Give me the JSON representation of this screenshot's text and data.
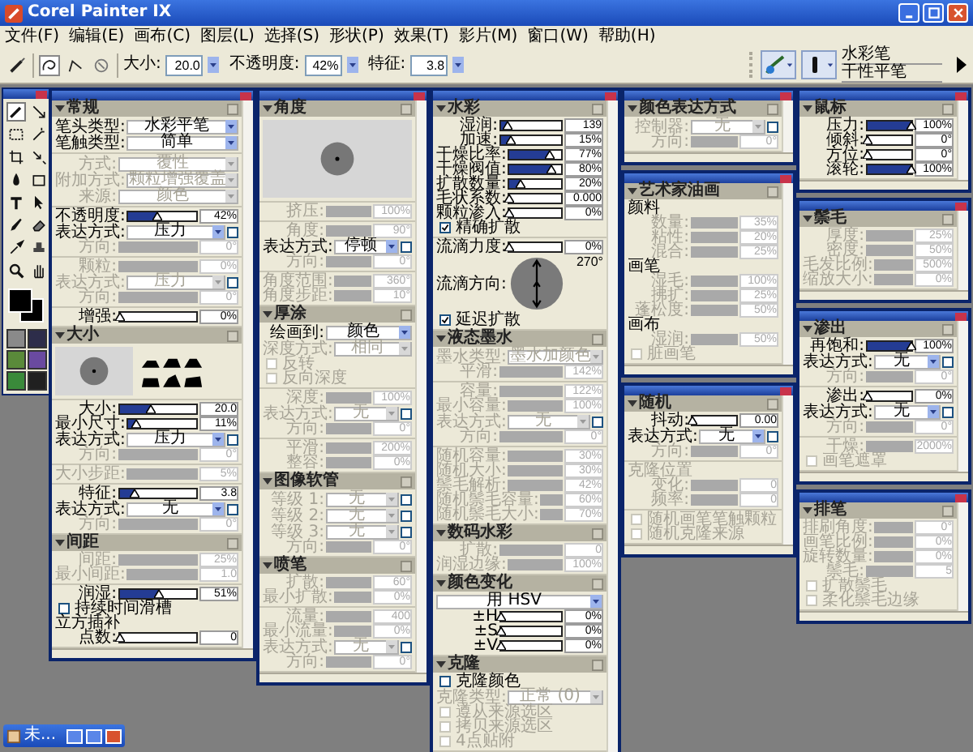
{
  "window": {
    "title": "Corel Painter IX"
  },
  "menu": [
    "文件(F)",
    "编辑(E)",
    "画布(C)",
    "图层(L)",
    "选择(S)",
    "形状(P)",
    "效果(T)",
    "影片(M)",
    "窗口(W)",
    "帮助(H)"
  ],
  "toolbar": {
    "fields": [
      {
        "label": "大小:",
        "value": "20.0"
      },
      {
        "label": "不透明度:",
        "value": "42%"
      },
      {
        "label": "特征:",
        "value": "3.8"
      }
    ],
    "brush": {
      "category": "水彩笔",
      "variant": "干性平笔"
    }
  },
  "toolbox": {
    "tools": [
      {
        "selected": true
      },
      {
        "selected": false
      },
      {
        "selected": false
      },
      {
        "selected": false
      },
      {
        "selected": false
      },
      {
        "selected": false
      },
      {
        "selected": false
      },
      {
        "selected": false
      },
      {
        "selected": false
      },
      {
        "selected": false
      },
      {
        "selected": false
      },
      {
        "selected": false
      },
      {
        "selected": false
      },
      {
        "selected": false
      },
      {
        "selected": false
      },
      {
        "selected": false
      }
    ]
  },
  "palette_columns": [
    {
      "panels": [
        {
          "sections": [
            {
              "title": "常规",
              "groups": [
                {
                  "rows": [
                    {
                      "kind": "select",
                      "label": "笔头类型:",
                      "value": "水彩平笔",
                      "disabled": false
                    },
                    {
                      "kind": "select",
                      "label": "笔触类型:",
                      "value": "简单",
                      "disabled": false
                    }
                  ]
                },
                {
                  "rows": [
                    {
                      "kind": "select",
                      "label": "方式:",
                      "value": "覆性",
                      "disabled": true
                    },
                    {
                      "kind": "select",
                      "label": "附加方式:",
                      "value": "颗粒增强覆盖",
                      "disabled": true
                    },
                    {
                      "kind": "select",
                      "label": "来源:",
                      "value": "颜色",
                      "disabled": true
                    }
                  ]
                },
                {
                  "rows": [
                    {
                      "kind": "slider",
                      "label": "不透明度:",
                      "value": "42%",
                      "level": 0.42,
                      "disabled": false
                    },
                    {
                      "kind": "select",
                      "label": "表达方式:",
                      "value": "压力",
                      "disabled": false,
                      "toggle": {
                        "checked": false
                      }
                    },
                    {
                      "kind": "slider",
                      "label": "方向:",
                      "value": "0°",
                      "disabled": true
                    }
                  ]
                },
                {
                  "rows": [
                    {
                      "kind": "slider",
                      "label": "颗粒:",
                      "value": "0%",
                      "disabled": true
                    },
                    {
                      "kind": "select",
                      "label": "表达方式:",
                      "value": "压力",
                      "disabled": true,
                      "toggle": {
                        "checked": false
                      }
                    },
                    {
                      "kind": "slider",
                      "label": "方向:",
                      "value": "0°",
                      "disabled": true
                    }
                  ]
                },
                {
                  "rows": [
                    {
                      "kind": "slider",
                      "label": "增强:",
                      "value": "0%",
                      "level": 0,
                      "disabled": false
                    }
                  ]
                }
              ]
            },
            {
              "title": "大小",
              "groups": [
                {
                  "rows": [
                    {
                      "kind": "size_preview"
                    }
                  ]
                },
                {
                  "rows": [
                    {
                      "kind": "slider",
                      "label": "大小:",
                      "value": "20.0",
                      "level": 0.4,
                      "disabled": false
                    },
                    {
                      "kind": "slider",
                      "label": "最小尺寸:",
                      "value": "11%",
                      "level": 0.11,
                      "disabled": false
                    },
                    {
                      "kind": "select",
                      "label": "表达方式:",
                      "value": "压力",
                      "disabled": false,
                      "toggle": {
                        "checked": false
                      }
                    },
                    {
                      "kind": "slider",
                      "label": "方向:",
                      "value": "0°",
                      "disabled": true
                    }
                  ]
                },
                {
                  "rows": [
                    {
                      "kind": "slider",
                      "label": "大小步距:",
                      "value": "5%",
                      "disabled": true
                    }
                  ]
                },
                {
                  "rows": [
                    {
                      "kind": "slider",
                      "label": "特征:",
                      "value": "3.8",
                      "level": 0.2,
                      "disabled": false
                    },
                    {
                      "kind": "select",
                      "label": "表达方式:",
                      "value": "无",
                      "disabled": false,
                      "toggle": {
                        "checked": false
                      }
                    },
                    {
                      "kind": "slider",
                      "label": "方向:",
                      "value": "0°",
                      "disabled": true
                    }
                  ]
                }
              ]
            },
            {
              "title": "间距",
              "groups": [
                {
                  "rows": [
                    {
                      "kind": "slider",
                      "label": "间距:",
                      "value": "25%",
                      "disabled": true
                    },
                    {
                      "kind": "slider",
                      "label": "最小间距:",
                      "value": "1.0",
                      "disabled": true
                    }
                  ]
                },
                {
                  "rows": [
                    {
                      "kind": "slider",
                      "label": "润湿:",
                      "value": "51%",
                      "level": 0.51,
                      "disabled": false
                    },
                    {
                      "kind": "check",
                      "label": "持续时间滑槽",
                      "checked": false,
                      "disabled": false
                    },
                    {
                      "kind": "note",
                      "text": "立方插补",
                      "disabled": false
                    },
                    {
                      "kind": "slider",
                      "label": "点数:",
                      "value": "0",
                      "level": 0,
                      "disabled": false
                    }
                  ]
                }
              ]
            }
          ]
        }
      ]
    },
    {
      "panels": [
        {
          "sections": [
            {
              "title": "角度",
              "groups": [
                {
                  "rows": [
                    {
                      "kind": "dab"
                    }
                  ]
                },
                {
                  "rows": [
                    {
                      "kind": "slider",
                      "label": "挤压:",
                      "value": "100%",
                      "disabled": true
                    }
                  ]
                },
                {
                  "rows": [
                    {
                      "kind": "slider",
                      "label": "角度:",
                      "value": "90°",
                      "disabled": true
                    },
                    {
                      "kind": "select",
                      "label": "表达方式:",
                      "value": "停顿",
                      "disabled": false,
                      "toggle": {
                        "checked": false
                      }
                    },
                    {
                      "kind": "slider",
                      "label": "方向:",
                      "value": "0°",
                      "disabled": true
                    }
                  ]
                },
                {
                  "rows": [
                    {
                      "kind": "slider",
                      "label": "角度范围:",
                      "value": "360°",
                      "disabled": true
                    },
                    {
                      "kind": "slider",
                      "label": "角度步距:",
                      "value": "10°",
                      "disabled": true
                    }
                  ]
                }
              ]
            },
            {
              "title": "厚涂",
              "groups": [
                {
                  "rows": [
                    {
                      "kind": "select",
                      "label": "绘画到:",
                      "value": "颜色",
                      "disabled": false
                    },
                    {
                      "kind": "select",
                      "label": "深度方式:",
                      "value": "相同",
                      "disabled": true
                    },
                    {
                      "kind": "check",
                      "label": "反转",
                      "checked": false,
                      "disabled": true
                    },
                    {
                      "kind": "check",
                      "label": "反向深度",
                      "checked": false,
                      "disabled": true
                    }
                  ]
                },
                {
                  "rows": [
                    {
                      "kind": "slider",
                      "label": "深度:",
                      "value": "100%",
                      "disabled": true
                    },
                    {
                      "kind": "select",
                      "label": "表达方式:",
                      "value": "无",
                      "disabled": true,
                      "toggle": {
                        "checked": false
                      }
                    },
                    {
                      "kind": "slider",
                      "label": "方向:",
                      "value": "0°",
                      "disabled": true
                    }
                  ]
                },
                {
                  "rows": [
                    {
                      "kind": "slider",
                      "label": "平滑:",
                      "value": "200%",
                      "disabled": true
                    },
                    {
                      "kind": "slider",
                      "label": "整容:",
                      "value": "0%",
                      "disabled": true
                    }
                  ]
                }
              ]
            },
            {
              "title": "图像软管",
              "groups": [
                {
                  "rows": [
                    {
                      "kind": "select",
                      "label": "等级 1:",
                      "value": "无",
                      "disabled": true,
                      "toggle": {
                        "checked": false
                      }
                    },
                    {
                      "kind": "select",
                      "label": "等级 2:",
                      "value": "无",
                      "disabled": true,
                      "toggle": {
                        "checked": false
                      }
                    },
                    {
                      "kind": "select",
                      "label": "等级 3:",
                      "value": "无",
                      "disabled": true,
                      "toggle": {
                        "checked": false
                      }
                    },
                    {
                      "kind": "slider",
                      "label": "方向:",
                      "value": "0°",
                      "disabled": true
                    }
                  ]
                }
              ]
            },
            {
              "title": "喷笔",
              "groups": [
                {
                  "rows": [
                    {
                      "kind": "slider",
                      "label": "扩散:",
                      "value": "60°",
                      "disabled": true
                    },
                    {
                      "kind": "slider",
                      "label": "最小扩散:",
                      "value": "0%",
                      "disabled": true
                    }
                  ]
                },
                {
                  "rows": [
                    {
                      "kind": "slider",
                      "label": "流量:",
                      "value": "400",
                      "disabled": true
                    },
                    {
                      "kind": "slider",
                      "label": "最小流量:",
                      "value": "0%",
                      "disabled": true
                    },
                    {
                      "kind": "select",
                      "label": "表达方式:",
                      "value": "无",
                      "disabled": true,
                      "toggle": {
                        "checked": false
                      }
                    },
                    {
                      "kind": "slider",
                      "label": "方向:",
                      "value": "0°",
                      "disabled": true
                    }
                  ]
                }
              ]
            }
          ]
        }
      ]
    },
    {
      "panels": [
        {
          "sections": [
            {
              "title": "水彩",
              "groups": [
                {
                  "rows": [
                    {
                      "kind": "slider",
                      "label": "湿润:",
                      "value": "139",
                      "level": 0.12,
                      "disabled": false
                    },
                    {
                      "kind": "slider",
                      "label": "加速:",
                      "value": "15%",
                      "level": 0.15,
                      "disabled": false
                    },
                    {
                      "kind": "slider",
                      "label": "干燥比率:",
                      "value": "77%",
                      "level": 0.77,
                      "disabled": false
                    },
                    {
                      "kind": "slider",
                      "label": "干燥阀值:",
                      "value": "80%",
                      "level": 0.8,
                      "disabled": false
                    },
                    {
                      "kind": "slider",
                      "label": "扩散数量:",
                      "value": "20%",
                      "level": 0.2,
                      "disabled": false
                    },
                    {
                      "kind": "slider",
                      "label": "毛状系数:",
                      "value": "0.000",
                      "level": 0,
                      "disabled": false
                    },
                    {
                      "kind": "slider",
                      "label": "颗粒渗入:",
                      "value": "0%",
                      "level": 0,
                      "disabled": false
                    },
                    {
                      "kind": "check",
                      "label": "精确扩散",
                      "checked": true,
                      "disabled": false
                    }
                  ]
                },
                {
                  "rows": [
                    {
                      "kind": "slider",
                      "label": "流滴力度:",
                      "value": "0%",
                      "level": 0,
                      "disabled": false
                    },
                    {
                      "kind": "dial",
                      "label": "流滴方向:",
                      "value": "270°"
                    },
                    {
                      "kind": "check",
                      "label": "延迟扩散",
                      "checked": true,
                      "disabled": false
                    }
                  ]
                }
              ]
            },
            {
              "title": "液态墨水",
              "groups": [
                {
                  "rows": [
                    {
                      "kind": "select",
                      "label": "墨水类型:",
                      "value": "墨水加颜色",
                      "disabled": true
                    },
                    {
                      "kind": "slider",
                      "label": "平滑:",
                      "value": "142%",
                      "disabled": true
                    }
                  ]
                },
                {
                  "rows": [
                    {
                      "kind": "slider",
                      "label": "容量:",
                      "value": "122%",
                      "disabled": true
                    },
                    {
                      "kind": "slider",
                      "label": "最小容量:",
                      "value": "100%",
                      "disabled": true
                    },
                    {
                      "kind": "select",
                      "label": "表达方式:",
                      "value": "无",
                      "disabled": true,
                      "toggle": {
                        "checked": false
                      }
                    },
                    {
                      "kind": "slider",
                      "label": "方向:",
                      "value": "0°",
                      "disabled": true
                    }
                  ]
                },
                {
                  "rows": [
                    {
                      "kind": "slider",
                      "label": "随机容量:",
                      "value": "30%",
                      "disabled": true
                    },
                    {
                      "kind": "slider",
                      "label": "随机大小:",
                      "value": "30%",
                      "disabled": true
                    },
                    {
                      "kind": "slider",
                      "label": "鬃毛解析:",
                      "value": "42%",
                      "disabled": true
                    },
                    {
                      "kind": "slider",
                      "label": "随机鬃毛容量:",
                      "value": "60%",
                      "disabled": true
                    },
                    {
                      "kind": "slider",
                      "label": "随机鬃毛大小:",
                      "value": "70%",
                      "disabled": true
                    }
                  ]
                }
              ]
            },
            {
              "title": "数码水彩",
              "groups": [
                {
                  "rows": [
                    {
                      "kind": "slider",
                      "label": "扩散:",
                      "value": "0",
                      "disabled": true
                    },
                    {
                      "kind": "slider",
                      "label": "润湿边缘:",
                      "value": "100%",
                      "disabled": true
                    }
                  ]
                }
              ]
            },
            {
              "title": "颜色变化",
              "groups": [
                {
                  "rows": [
                    {
                      "kind": "select",
                      "value": "用 HSV",
                      "disabled": false
                    },
                    {
                      "kind": "slider",
                      "label": "±H",
                      "value": "0%",
                      "level": 0,
                      "disabled": false
                    },
                    {
                      "kind": "slider",
                      "label": "±S",
                      "value": "0%",
                      "level": 0,
                      "disabled": false
                    },
                    {
                      "kind": "slider",
                      "label": "±V",
                      "value": "0%",
                      "level": 0,
                      "disabled": false
                    }
                  ]
                }
              ]
            },
            {
              "title": "克隆",
              "groups": [
                {
                  "rows": [
                    {
                      "kind": "check",
                      "label": "克隆颜色",
                      "checked": false,
                      "disabled": false
                    },
                    {
                      "kind": "select",
                      "label": "克隆类型:",
                      "value": "正常 (0)",
                      "disabled": true
                    },
                    {
                      "kind": "check",
                      "label": "遵从来源选区",
                      "checked": false,
                      "disabled": true
                    },
                    {
                      "kind": "check",
                      "label": "拷贝来源选区",
                      "checked": false,
                      "disabled": true
                    },
                    {
                      "kind": "check",
                      "label": "4点贴附",
                      "checked": false,
                      "disabled": true
                    }
                  ]
                }
              ]
            }
          ]
        }
      ]
    },
    {
      "panels": [
        {
          "sections": [
            {
              "title": "颜色表达方式",
              "groups": [
                {
                  "rows": [
                    {
                      "kind": "select",
                      "label": "控制器:",
                      "value": "无",
                      "disabled": true,
                      "toggle": {
                        "checked": false
                      }
                    },
                    {
                      "kind": "slider",
                      "label": "方向:",
                      "value": "0°",
                      "disabled": true
                    }
                  ]
                }
              ]
            }
          ]
        },
        {
          "sections": [
            {
              "title": "艺术家油画",
              "groups": [
                {
                  "rows": [
                    {
                      "kind": "note",
                      "text": "颜料",
                      "disabled": false
                    },
                    {
                      "kind": "slider",
                      "label": "数量:",
                      "value": "35%",
                      "disabled": true
                    },
                    {
                      "kind": "slider",
                      "label": "粘性:",
                      "value": "20%",
                      "disabled": true
                    },
                    {
                      "kind": "slider",
                      "label": "混合:",
                      "value": "25%",
                      "disabled": true
                    },
                    {
                      "kind": "note",
                      "text": "画笔",
                      "disabled": false
                    },
                    {
                      "kind": "slider",
                      "label": "湿毛:",
                      "value": "100%",
                      "disabled": true
                    },
                    {
                      "kind": "slider",
                      "label": "拂扩:",
                      "value": "25%",
                      "disabled": true
                    },
                    {
                      "kind": "slider",
                      "label": "蓬松度:",
                      "value": "50%",
                      "disabled": true
                    },
                    {
                      "kind": "note",
                      "text": "画布",
                      "disabled": false
                    },
                    {
                      "kind": "slider",
                      "label": "湿润:",
                      "value": "50%",
                      "disabled": true
                    },
                    {
                      "kind": "check",
                      "label": "脏画笔",
                      "checked": false,
                      "disabled": true
                    }
                  ]
                }
              ]
            }
          ]
        },
        {
          "sections": [
            {
              "title": "随机",
              "groups": [
                {
                  "rows": [
                    {
                      "kind": "slider",
                      "label": "抖动:",
                      "value": "0.00",
                      "level": 0,
                      "disabled": false
                    },
                    {
                      "kind": "select",
                      "label": "表达方式:",
                      "value": "无",
                      "disabled": false,
                      "toggle": {
                        "checked": false
                      }
                    },
                    {
                      "kind": "slider",
                      "label": "方向:",
                      "value": "0°",
                      "disabled": true
                    }
                  ]
                },
                {
                  "rows": [
                    {
                      "kind": "note",
                      "text": "克隆位置",
                      "disabled": true
                    },
                    {
                      "kind": "slider",
                      "label": "变化:",
                      "value": "0",
                      "disabled": true
                    },
                    {
                      "kind": "slider",
                      "label": "频率:",
                      "value": "0",
                      "disabled": true
                    }
                  ]
                },
                {
                  "rows": [
                    {
                      "kind": "check",
                      "label": "随机画笔笔触颗粒",
                      "checked": false,
                      "disabled": true
                    },
                    {
                      "kind": "check",
                      "label": "随机克隆来源",
                      "checked": false,
                      "disabled": true
                    }
                  ]
                }
              ]
            }
          ]
        }
      ]
    },
    {
      "panels": [
        {
          "sections": [
            {
              "title": "鼠标",
              "groups": [
                {
                  "rows": [
                    {
                      "kind": "slider",
                      "label": "压力:",
                      "value": "100%",
                      "level": 1,
                      "disabled": false
                    },
                    {
                      "kind": "slider",
                      "label": "倾斜:",
                      "value": "0°",
                      "level": 0,
                      "disabled": false
                    },
                    {
                      "kind": "slider",
                      "label": "方位:",
                      "value": "0°",
                      "level": 0,
                      "disabled": false
                    },
                    {
                      "kind": "slider",
                      "label": "滚轮:",
                      "value": "100%",
                      "level": 1,
                      "disabled": false
                    }
                  ]
                }
              ]
            }
          ]
        },
        {
          "sections": [
            {
              "title": "鬃毛",
              "groups": [
                {
                  "rows": [
                    {
                      "kind": "slider",
                      "label": "厚度:",
                      "value": "25%",
                      "disabled": true
                    },
                    {
                      "kind": "slider",
                      "label": "密度:",
                      "value": "50%",
                      "disabled": true
                    },
                    {
                      "kind": "slider",
                      "label": "毛发比例:",
                      "value": "500%",
                      "disabled": true
                    },
                    {
                      "kind": "slider",
                      "label": "缩放大小:",
                      "value": "0%",
                      "disabled": true
                    }
                  ]
                }
              ]
            }
          ]
        },
        {
          "sections": [
            {
              "title": "渗出",
              "groups": [
                {
                  "rows": [
                    {
                      "kind": "slider",
                      "label": "再饱和:",
                      "value": "100%",
                      "level": 1,
                      "disabled": false
                    },
                    {
                      "kind": "select",
                      "label": "表达方式:",
                      "value": "无",
                      "disabled": false,
                      "toggle": {
                        "checked": false
                      }
                    },
                    {
                      "kind": "slider",
                      "label": "方向:",
                      "value": "0°",
                      "disabled": true
                    }
                  ]
                },
                {
                  "rows": [
                    {
                      "kind": "slider",
                      "label": "渗出:",
                      "value": "0%",
                      "level": 0,
                      "disabled": false
                    },
                    {
                      "kind": "select",
                      "label": "表达方式:",
                      "value": "无",
                      "disabled": false,
                      "toggle": {
                        "checked": false
                      }
                    },
                    {
                      "kind": "slider",
                      "label": "方向:",
                      "value": "0°",
                      "disabled": true
                    }
                  ]
                },
                {
                  "rows": [
                    {
                      "kind": "slider",
                      "label": "干燥:",
                      "value": "2000%",
                      "disabled": true
                    },
                    {
                      "kind": "check",
                      "label": "画笔遮罩",
                      "checked": false,
                      "disabled": true
                    }
                  ]
                }
              ]
            }
          ]
        },
        {
          "sections": [
            {
              "title": "排笔",
              "groups": [
                {
                  "rows": [
                    {
                      "kind": "slider",
                      "label": "排刷角度:",
                      "value": "0°",
                      "disabled": true
                    },
                    {
                      "kind": "slider",
                      "label": "画笔比例:",
                      "value": "0%",
                      "disabled": true
                    },
                    {
                      "kind": "slider",
                      "label": "旋转数量:",
                      "value": "0%",
                      "disabled": true
                    },
                    {
                      "kind": "slider",
                      "label": "鬃毛:",
                      "value": "5",
                      "disabled": true
                    },
                    {
                      "kind": "check",
                      "label": "扩散鬃毛",
                      "checked": false,
                      "disabled": true
                    },
                    {
                      "kind": "check",
                      "label": "柔化鬃毛边缘",
                      "checked": false,
                      "disabled": true
                    }
                  ]
                }
              ]
            }
          ]
        }
      ]
    }
  ],
  "minimized_window": {
    "title": "未..."
  }
}
